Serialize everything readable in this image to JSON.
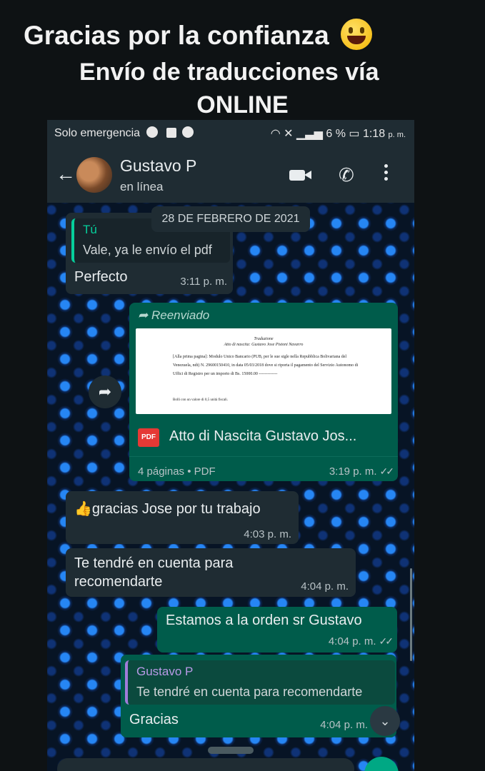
{
  "caption": {
    "line1": "Gracias por la confianza",
    "line2": "Envío de traducciones vía",
    "line3": "ONLINE",
    "emoji": "grinning-face-emoji"
  },
  "status_bar": {
    "left_text": "Solo emergencia",
    "battery": "6 %",
    "time": "1:18",
    "time_suffix": "p. m."
  },
  "header": {
    "contact_name": "Gustavo P",
    "status": "en línea"
  },
  "chat": {
    "date_chip": "28 DE FEBRERO DE 2021",
    "messages": [
      {
        "direction": "in",
        "quote_author": "Tú",
        "quote_text": "Vale, ya le envío el pdf",
        "text": "Perfecto",
        "time": "3:11 p. m."
      },
      {
        "direction": "out",
        "forwarded_label": "Reenviado",
        "doc_preview": {
          "title": "Traduzione",
          "subtitle": "Atto di nascita: Gustavo Jose Pistoni Navarro",
          "body": "[Alla prima pagina]: Modulo Unico Bancario (PUB, per le sue sigle nella Repubblica Bolivariana del Venezuela, ndt) N. 29600150410, in data 05/03/2018 dove si riporta il pagamento del Servizio Autonomo di Uffici di Registro per un importo di Bs. 15000.00 -------------",
          "footnote": "Bolli con un valore di 0,5 unità fiscali."
        },
        "file_name": "Atto di Nascita Gustavo Jos...",
        "file_badge": "PDF",
        "file_meta": "4 páginas • PDF",
        "time": "3:19 p. m."
      },
      {
        "direction": "in",
        "text": "gracias Jose por tu trabajo",
        "time": "4:03 p. m."
      },
      {
        "direction": "in",
        "text_line1": "Te tendré en cuenta para",
        "text_line2": "recomendarte",
        "time": "4:04 p. m."
      },
      {
        "direction": "out",
        "text": "Estamos a la orden sr Gustavo",
        "time": "4:04 p. m."
      },
      {
        "direction": "out",
        "quote_author": "Gustavo P",
        "quote_text": "Te tendré en cuenta para recomendarte",
        "text": "Gracias",
        "time": "4:04 p. m."
      }
    ]
  },
  "colors": {
    "incoming_bubble": "#1f2c33",
    "outgoing_bubble": "#005c4b",
    "quote_you_accent": "#06cf9c",
    "quote_contact_accent": "#a07cd9",
    "wallpaper_dot": "#288cff"
  }
}
